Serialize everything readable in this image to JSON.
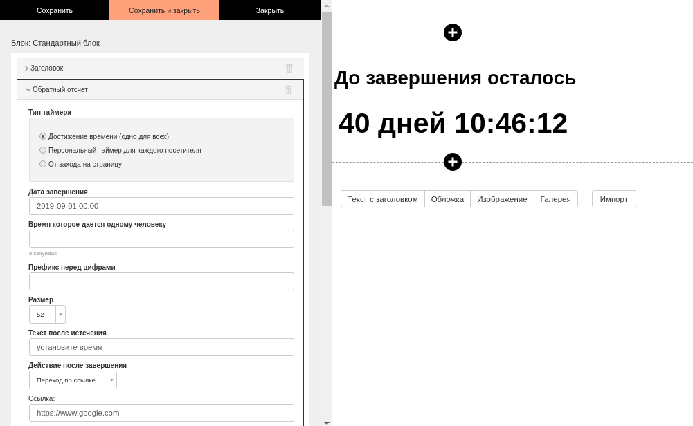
{
  "toolbar": {
    "buttons": [
      {
        "label": "Сохранить",
        "highlighted": false
      },
      {
        "label": "Сохранить и закрыть",
        "highlighted": true
      },
      {
        "label": "Закрыть",
        "highlighted": false
      }
    ]
  },
  "editor": {
    "block_title": "Блок: Стандартный блок",
    "sections": [
      {
        "title": "Заголовок",
        "expanded": false
      },
      {
        "title": "Обратный отсчет",
        "expanded": true,
        "fields": [
          {
            "kind": "radio_group",
            "label": "Тип таймера",
            "options": [
              {
                "label": "Достижение времени (одно для всех)",
                "selected": true
              },
              {
                "label": "Персональный таймер для каждого посетителя",
                "selected": false
              },
              {
                "label": "От захода на страницу",
                "selected": false
              }
            ]
          },
          {
            "kind": "text",
            "label": "Дата завершения",
            "value": "2019-09-01 00:00"
          },
          {
            "kind": "text",
            "label": "Время которое дается одному человеку",
            "help": "в секундах"
          },
          {
            "kind": "text",
            "label": "Префикс перед цифрами"
          },
          {
            "kind": "select",
            "label": "Размер",
            "value": "52"
          },
          {
            "kind": "text",
            "label": "Текст после истечения",
            "value": "установите время"
          },
          {
            "kind": "select",
            "label": "Действие после завершения",
            "value": "Переход по ссылке"
          },
          {
            "kind": "text",
            "label": "Ссылка:",
            "plain_label": true,
            "value": "https://www.google.com"
          }
        ]
      }
    ]
  },
  "preview": {
    "heading": "До завершения осталось",
    "countdown": "40 дней 10:46:12",
    "add_buttons": [
      "Текст с заголовком",
      "Обложка",
      "Изображение",
      "Галерея"
    ],
    "import_button": "Импорт"
  }
}
